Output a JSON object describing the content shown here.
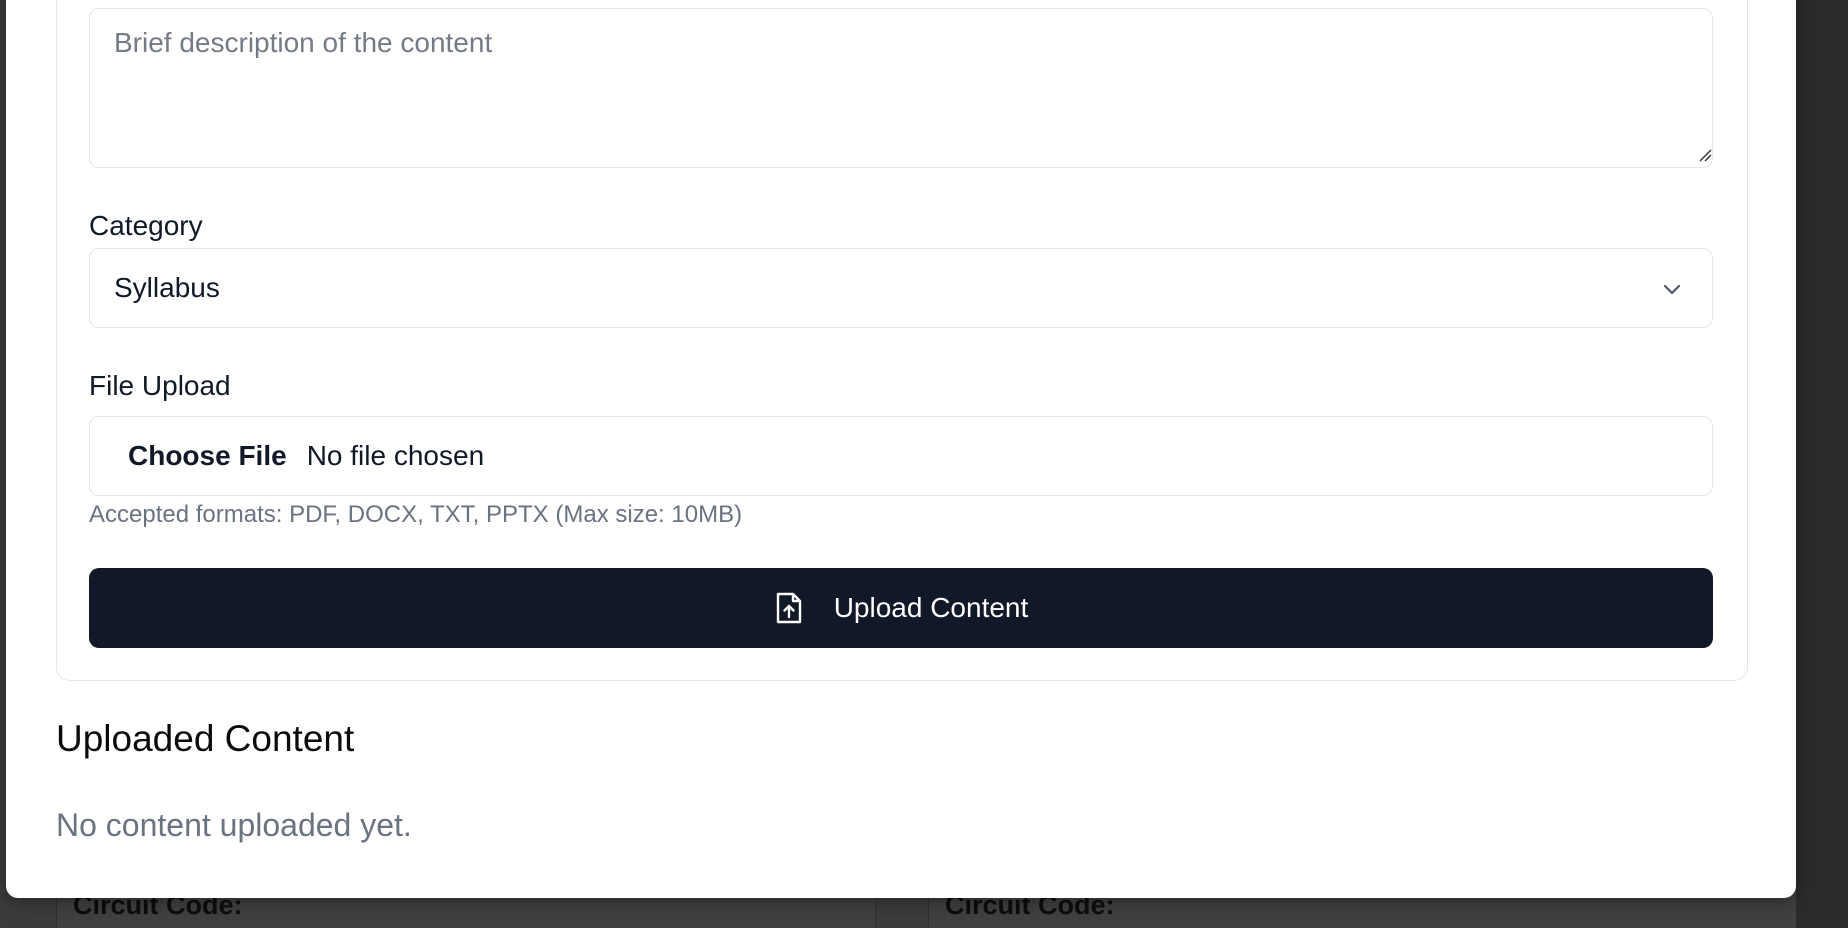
{
  "background": {
    "cards": [
      {
        "label": "Circuit Code:"
      },
      {
        "label": "Circuit Code:"
      }
    ]
  },
  "form": {
    "description": {
      "value": "",
      "placeholder": "Brief description of the content"
    },
    "category": {
      "label": "Category",
      "selected": "Syllabus",
      "icon": "chevron-down-icon"
    },
    "file_upload": {
      "label": "File Upload",
      "choose_label": "Choose File",
      "status": "No file chosen",
      "hint": "Accepted formats: PDF, DOCX, TXT, PPTX (Max size: 10MB)"
    },
    "submit": {
      "label": "Upload Content",
      "icon": "file-upload-icon"
    }
  },
  "uploaded": {
    "title": "Uploaded Content",
    "empty_message": "No content uploaded yet."
  },
  "colors": {
    "primary_button": "#111827",
    "muted_text": "#6b7280",
    "border": "#e5e7eb"
  }
}
